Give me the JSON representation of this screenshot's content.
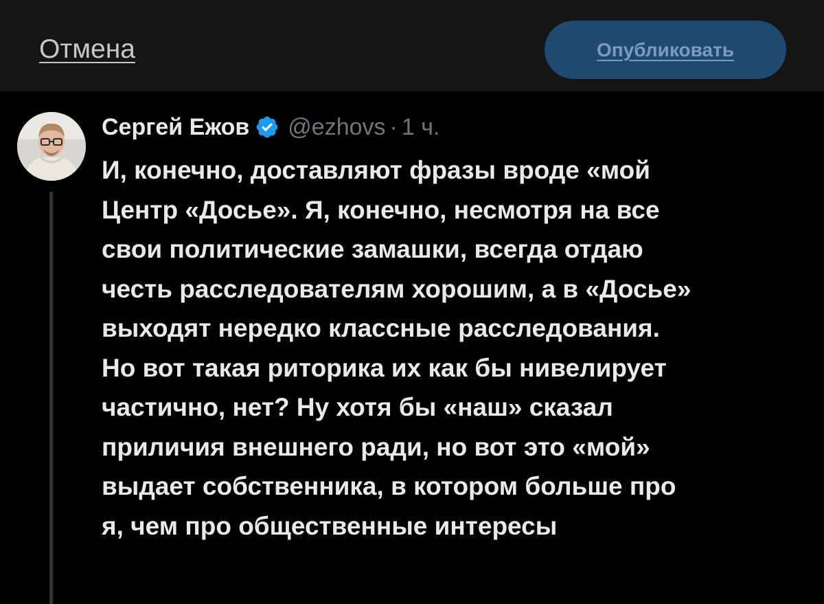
{
  "topbar": {
    "cancel_label": "Отмена",
    "publish_label": "Опубликовать",
    "publish_color": "#1e4a72"
  },
  "post": {
    "author_name": "Сергей Ежов",
    "verified_icon": "verified-badge-icon",
    "handle": "@ezhovs",
    "separator": "·",
    "time": "1 ч.",
    "text": "И, конечно, доставляют фразы вроде «мой\nЦентр «Досье». Я, конечно, несмотря на все\nсвои политические замашки, всегда отдаю\nчесть расследователям хорошим, а в «Досье»\nвыходят нередко классные расследования.\nНо вот такая риторика их как бы нивелирует\nчастично, нет? Ну хотя бы «наш» сказал\nприличия внешнего ради, но вот это «мой»\nвыдает собственника, в котором больше про\nя, чем про общественные интересы"
  },
  "colors": {
    "background": "#000000",
    "topbar_background": "#151515",
    "text_primary": "#e7e9ea",
    "text_secondary": "#71767b",
    "accent": "#1d9bf0"
  }
}
